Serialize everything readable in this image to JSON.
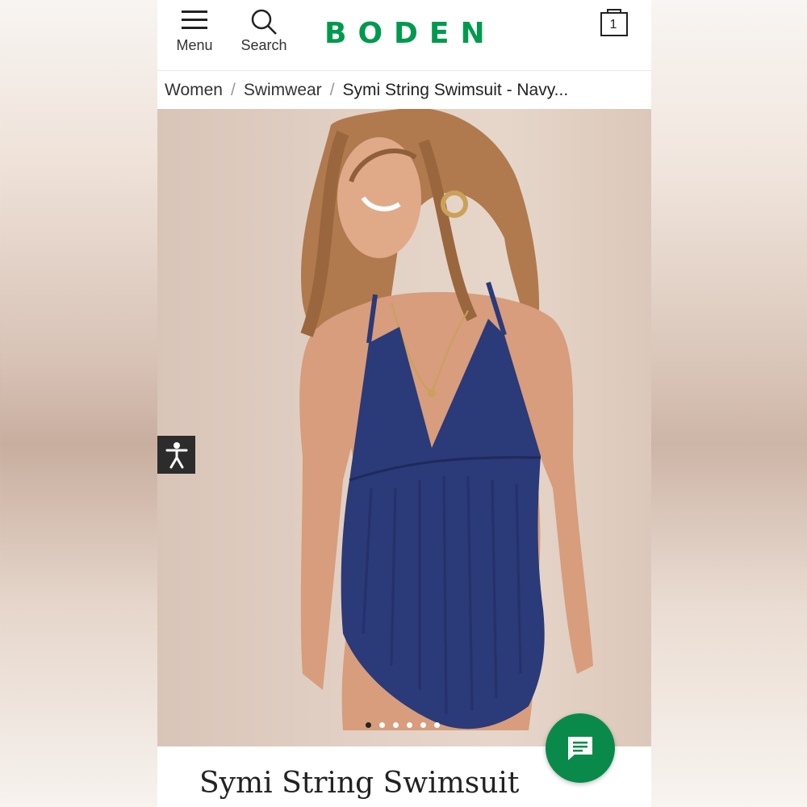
{
  "header": {
    "menu_label": "Menu",
    "search_label": "Search",
    "logo": "BODEN",
    "bag_count": "1",
    "logo_color": "#009a4e"
  },
  "breadcrumb": {
    "items": [
      "Women",
      "Swimwear"
    ],
    "current": "Symi String Swimsuit - Navy..."
  },
  "gallery": {
    "slide_count": 6,
    "active_index": 0
  },
  "product": {
    "title": "Symi String Swimsuit"
  },
  "icons": {
    "menu": "hamburger-icon",
    "search": "search-icon",
    "bag": "bag-icon",
    "accessibility": "accessibility-icon",
    "chat": "chat-icon"
  },
  "colors": {
    "chat_button": "#0a8a4a",
    "swimsuit": "#2b3a78"
  }
}
